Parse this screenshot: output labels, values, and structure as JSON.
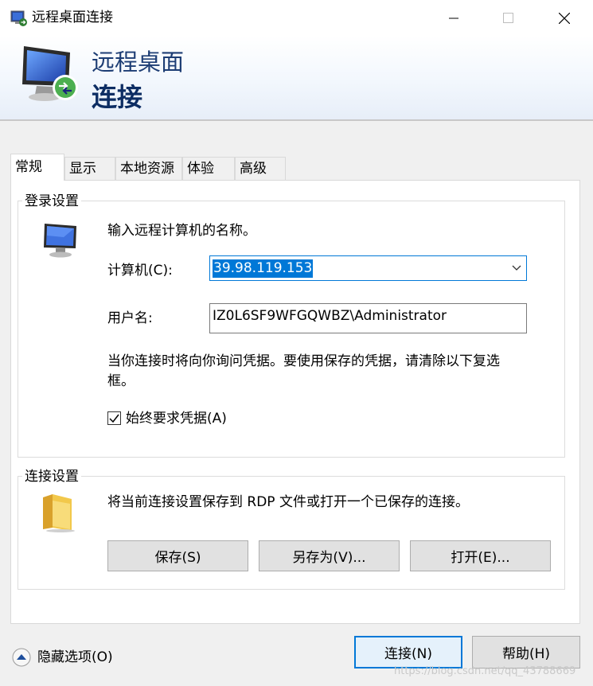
{
  "window": {
    "title": "远程桌面连接",
    "header_line1": "远程桌面",
    "header_line2": "连接"
  },
  "tabs": [
    {
      "label": "常规",
      "active": true
    },
    {
      "label": "显示",
      "active": false
    },
    {
      "label": "本地资源",
      "active": false
    },
    {
      "label": "体验",
      "active": false
    },
    {
      "label": "高级",
      "active": false
    }
  ],
  "login_settings": {
    "legend": "登录设置",
    "instruction": "输入远程计算机的名称。",
    "computer_label": "计算机(C):",
    "computer_value": "39.98.119.153",
    "username_label": "用户名:",
    "username_value": "IZ0L6SF9WFGQWBZ\\Administrator",
    "info_line1": "当你连接时将向你询问凭据。要使用保存的凭据，请清除以下复选",
    "info_line2": "框。",
    "always_ask_label": "始终要求凭据(A)",
    "always_ask_checked": true
  },
  "connection_settings": {
    "legend": "连接设置",
    "description": "将当前连接设置保存到 RDP 文件或打开一个已保存的连接。",
    "save_label": "保存(S)",
    "save_as_label": "另存为(V)...",
    "open_label": "打开(E)..."
  },
  "footer": {
    "hide_options_label": "隐藏选项(O)",
    "connect_label": "连接(N)",
    "help_label": "帮助(H)"
  },
  "watermark": "https://blog.csdn.net/qq_43788669",
  "colors": {
    "accent": "#0078d7",
    "header_text": "#1d3d74"
  }
}
